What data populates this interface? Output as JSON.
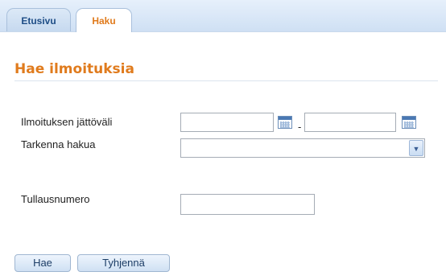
{
  "tabs": [
    {
      "label": "Etusivu",
      "active": false
    },
    {
      "label": "Haku",
      "active": true
    }
  ],
  "page": {
    "title": "Hae ilmoituksia"
  },
  "form": {
    "date_range": {
      "label": "Ilmoituksen jättöväli",
      "from_value": "",
      "to_value": "",
      "separator": "-"
    },
    "refine": {
      "label": "Tarkenna hakua",
      "selected": ""
    },
    "customs_number": {
      "label": "Tullausnumero",
      "value": ""
    }
  },
  "buttons": {
    "search": "Hae",
    "clear": "Tyhjennä"
  },
  "icons": {
    "calendar": "calendar-icon",
    "dropdown": "chevron-down-icon"
  },
  "colors": {
    "accent": "#e07b1d",
    "tab_text": "#1e4d86",
    "button_bg": "#dbe8f7"
  }
}
